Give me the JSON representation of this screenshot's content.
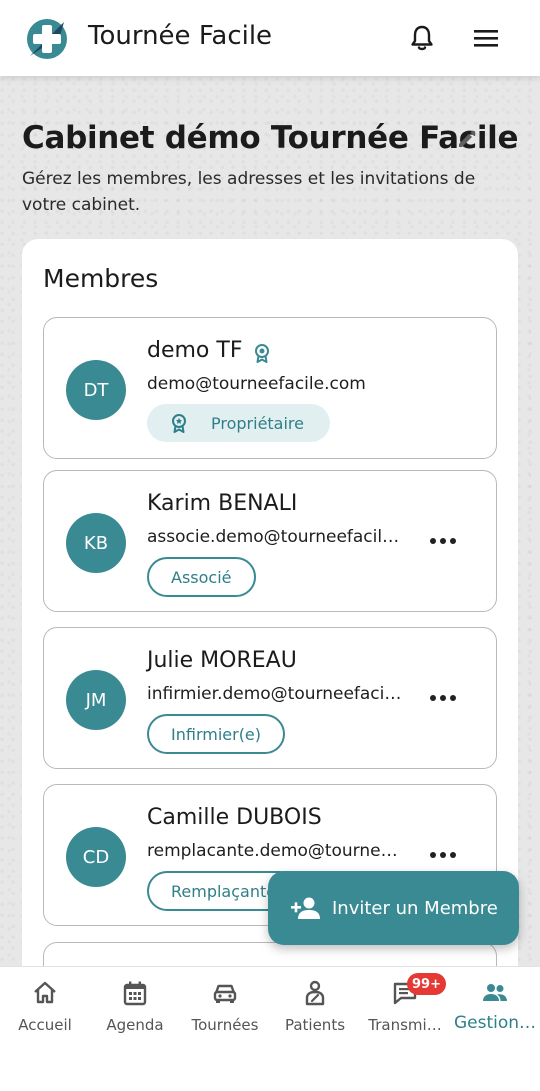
{
  "app": {
    "title": "Tournée Facile"
  },
  "page": {
    "title": "Cabinet démo Tournée Facile",
    "subtitle": "Gérez les membres, les adresses et les invitations de votre cabinet."
  },
  "members_section": {
    "title": "Membres",
    "members": [
      {
        "initials": "DT",
        "name": "demo TF",
        "email": "demo@tourneefacile.com",
        "role": "Propriétaire"
      },
      {
        "initials": "KB",
        "name": "Karim BENALI",
        "email": "associe.demo@tourneefacile.com",
        "role": "Associé"
      },
      {
        "initials": "JM",
        "name": "Julie MOREAU",
        "email": "infirmier.demo@tourneefacile.com",
        "role": "Infirmier(e)"
      },
      {
        "initials": "CD",
        "name": "Camille DUBOIS",
        "email": "remplacante.demo@tourneefacile.com",
        "role": "Remplaçante"
      }
    ]
  },
  "fab": {
    "label": "Inviter un Membre"
  },
  "bottom_nav": {
    "items": [
      {
        "label": "Accueil",
        "icon": "home-icon"
      },
      {
        "label": "Agenda",
        "icon": "calendar-icon"
      },
      {
        "label": "Tournées",
        "icon": "car-icon"
      },
      {
        "label": "Patients",
        "icon": "patient-icon"
      },
      {
        "label": "Transmi…",
        "icon": "chat-icon",
        "badge": "99+"
      },
      {
        "label": "Gestion…",
        "icon": "group-icon",
        "active": true
      }
    ]
  },
  "colors": {
    "accent": "#3a8a93",
    "badge": "#e53935"
  }
}
